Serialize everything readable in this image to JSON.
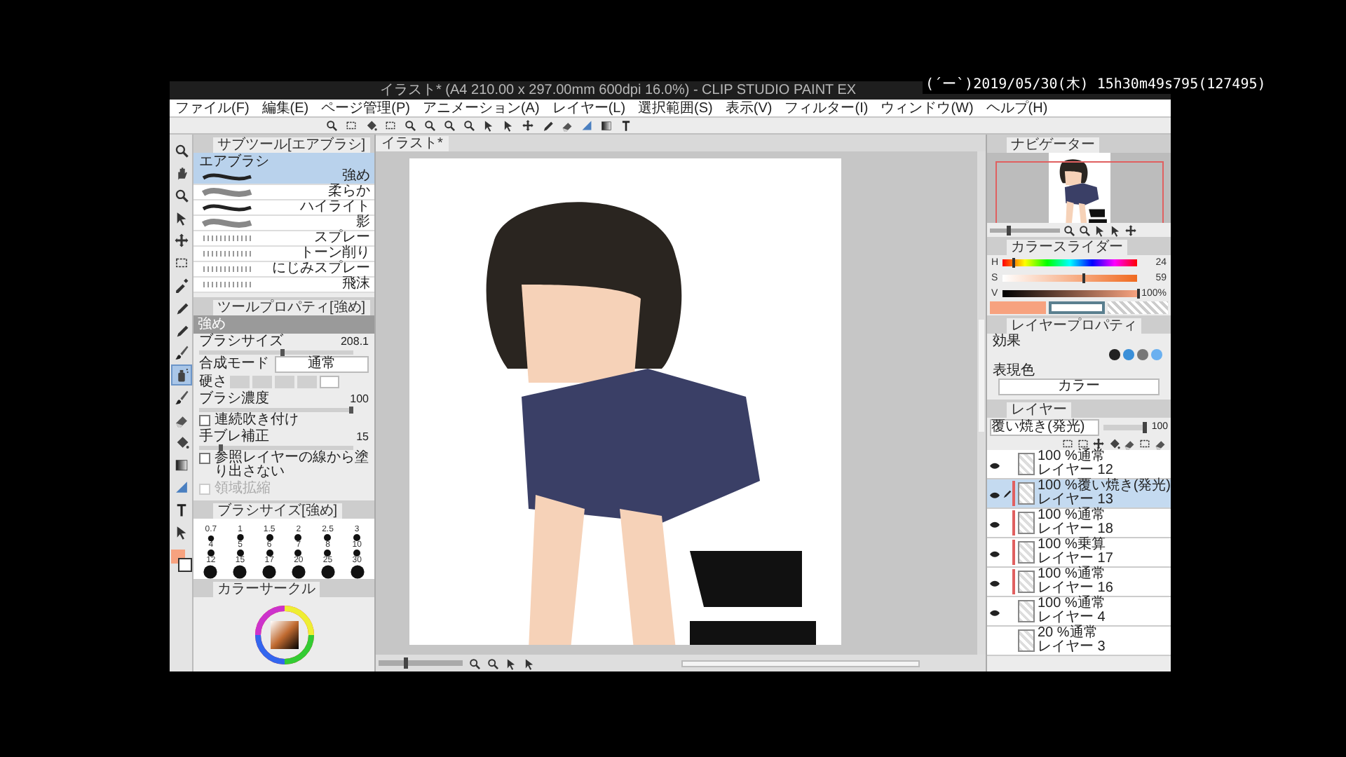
{
  "overlay_timestamp": "(´ー`)2019/05/30(木) 15h30m49s795(127495)",
  "window": {
    "title": "イラスト* (A4 210.00 x 297.00mm 600dpi 16.0%) - CLIP STUDIO PAINT EX"
  },
  "menu": [
    "ファイル(F)",
    "編集(E)",
    "ページ管理(P)",
    "アニメーション(A)",
    "レイヤー(L)",
    "選択範囲(S)",
    "表示(V)",
    "フィルター(I)",
    "ウィンドウ(W)",
    "ヘルプ(H)"
  ],
  "tools": [
    {
      "kind": "magnifier",
      "selected": false
    },
    {
      "kind": "hand",
      "selected": false
    },
    {
      "kind": "magnifier",
      "selected": false
    },
    {
      "kind": "arrow",
      "selected": false
    },
    {
      "kind": "move",
      "selected": false
    },
    {
      "kind": "select",
      "selected": false
    },
    {
      "kind": "eyedropper",
      "selected": false
    },
    {
      "kind": "pen",
      "selected": false
    },
    {
      "kind": "pen",
      "selected": false
    },
    {
      "kind": "brush",
      "selected": false
    },
    {
      "kind": "spray",
      "selected": true
    },
    {
      "kind": "brush",
      "selected": false
    },
    {
      "kind": "eraser",
      "selected": false
    },
    {
      "kind": "bucket",
      "selected": false
    },
    {
      "kind": "gradient",
      "selected": false
    },
    {
      "kind": "ruler",
      "selected": false
    },
    {
      "kind": "text",
      "selected": false
    },
    {
      "kind": "arrow",
      "selected": false
    }
  ],
  "subtool_panel": {
    "title": "サブツール[エアブラシ]",
    "group": "エアブラシ",
    "items": [
      {
        "label": "強め",
        "selected": true
      },
      {
        "label": "柔らか",
        "selected": false
      },
      {
        "label": "ハイライト",
        "selected": false
      },
      {
        "label": "影",
        "selected": false
      },
      {
        "label": "スプレー",
        "selected": false
      },
      {
        "label": "トーン削り",
        "selected": false
      },
      {
        "label": "にじみスプレー",
        "selected": false
      },
      {
        "label": "飛沫",
        "selected": false
      }
    ]
  },
  "tool_property": {
    "title": "ツールプロパティ[強め]",
    "preset": "強め",
    "rows": [
      {
        "kind": "slider",
        "label": "ブラシサイズ",
        "value": "208.1",
        "level": 0.55
      },
      {
        "kind": "dropdown",
        "label": "合成モード",
        "value": "通常"
      },
      {
        "kind": "hardness",
        "label": "硬さ",
        "steps": [
          {
            "selected": false
          },
          {
            "selected": false
          },
          {
            "selected": false
          },
          {
            "selected": false
          },
          {
            "selected": true
          }
        ]
      },
      {
        "kind": "slider",
        "label": "ブラシ濃度",
        "value": "100",
        "level": 1
      },
      {
        "kind": "checkbox",
        "label": "連続吹き付け",
        "checked": false,
        "disabled": false
      },
      {
        "kind": "slider",
        "label": "手ブレ補正",
        "value": "15",
        "level": 0.15
      },
      {
        "kind": "checkbox",
        "label": "参照レイヤーの線から塗り出さない",
        "checked": false,
        "disabled": false
      },
      {
        "kind": "checkbox",
        "label": "領域拡縮",
        "checked": false,
        "disabled": true
      }
    ]
  },
  "brush_size_panel": {
    "title": "ブラシサイズ[強め]",
    "sizes": [
      "0.7",
      "1",
      "1.5",
      "2",
      "2.5",
      "3",
      "4",
      "5",
      "6",
      "7",
      "8",
      "10",
      "12",
      "15",
      "17",
      "20",
      "25",
      "30"
    ]
  },
  "color_circle": {
    "title": "カラーサークル"
  },
  "navigator": {
    "title": "ナビゲーター",
    "zoom_slider": {
      "level": 0.3
    }
  },
  "canvas_zoom_slider": {
    "level": 0.35
  },
  "color_slider": {
    "title": "カラースライダー",
    "channels": [
      {
        "label": "H",
        "value": "24",
        "level": 0.07
      },
      {
        "label": "S",
        "value": "59",
        "level": 0.59
      },
      {
        "label": "V",
        "value": "100%",
        "level": 1
      }
    ]
  },
  "layer_property": {
    "title": "レイヤープロパティ",
    "effect_label": "効果",
    "expression_label": "表現色",
    "expression_value": "カラー"
  },
  "layer_panel": {
    "title": "レイヤー",
    "blend_mode": "覆い焼き(発光)",
    "opacity": "100",
    "opacity_slider": {
      "level": 1
    },
    "layers": [
      {
        "mode": "100 %通常",
        "name": "レイヤー 12",
        "visible": true,
        "clipped": false,
        "selected": false
      },
      {
        "mode": "100 %覆い焼き(発光)",
        "name": "レイヤー 13",
        "visible": true,
        "clipped": true,
        "selected": true
      },
      {
        "mode": "100 %通常",
        "name": "レイヤー 18",
        "visible": true,
        "clipped": true,
        "selected": false
      },
      {
        "mode": "100 %乗算",
        "name": "レイヤー 17",
        "visible": true,
        "clipped": true,
        "selected": false
      },
      {
        "mode": "100 %通常",
        "name": "レイヤー 16",
        "visible": true,
        "clipped": true,
        "selected": false
      },
      {
        "mode": "100 %通常",
        "name": "レイヤー 4",
        "visible": true,
        "clipped": false,
        "selected": false
      },
      {
        "mode": "20 %通常",
        "name": "レイヤー 3",
        "visible": false,
        "clipped": false,
        "selected": false
      }
    ]
  },
  "document_tab": "イラスト*"
}
